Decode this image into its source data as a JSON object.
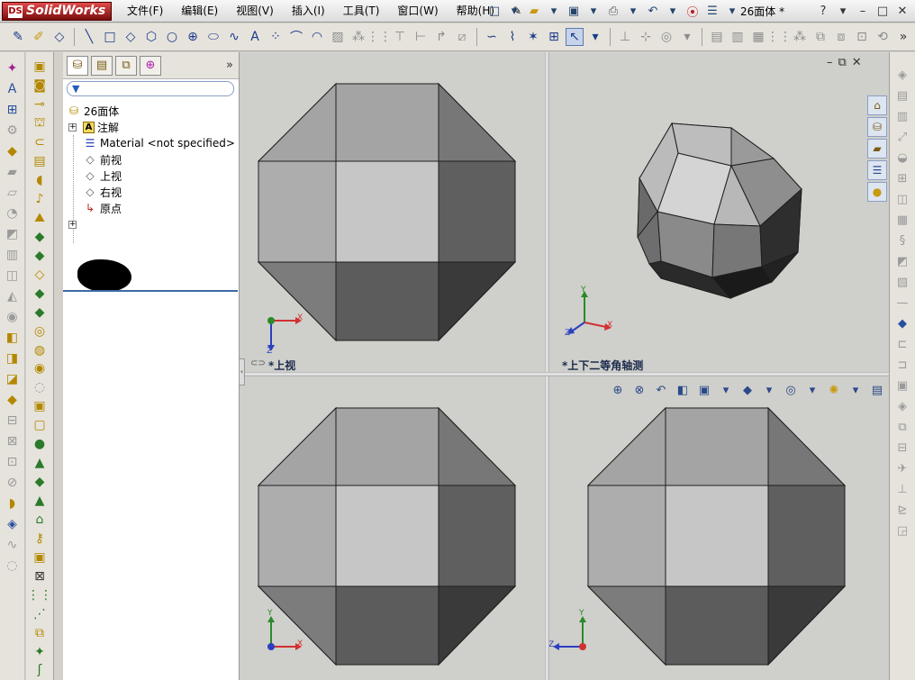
{
  "app": {
    "name": "SolidWorks",
    "document_title": "26面体 *"
  },
  "menu": [
    "文件(F)",
    "编辑(E)",
    "视图(V)",
    "插入(I)",
    "工具(T)",
    "窗口(W)",
    "帮助(H)"
  ],
  "icons": {
    "new": "new-document-icon",
    "open": "open-icon",
    "save": "save-icon",
    "print": "print-icon",
    "undo": "undo-icon",
    "rebuild": "rebuild-icon",
    "options": "options-icon",
    "help": "help-icon",
    "minimize": "minimize-icon",
    "restore": "restore-icon",
    "close": "close-icon"
  },
  "feature_tree": {
    "filter_placeholder": "",
    "root": "26面体",
    "items": [
      {
        "label": "注解",
        "icon": "annotations-icon",
        "expandable": true
      },
      {
        "label": "Material <not specified>",
        "icon": "material-icon",
        "expandable": false
      },
      {
        "label": "前视",
        "icon": "plane-icon",
        "expandable": false
      },
      {
        "label": "上视",
        "icon": "plane-icon",
        "expandable": false
      },
      {
        "label": "右视",
        "icon": "plane-icon",
        "expandable": false
      },
      {
        "label": "原点",
        "icon": "origin-icon",
        "expandable": false
      }
    ]
  },
  "viewports": {
    "top_left": {
      "label": "*上视",
      "triad": {
        "h": "X",
        "v": "Z"
      }
    },
    "top_right": {
      "label": "*上下二等角轴测",
      "triad": {
        "h": "X",
        "v": "Y",
        "d": "Z"
      }
    },
    "bottom_left": {
      "label": "",
      "triad": {
        "h": "X",
        "v": "Y"
      }
    },
    "bottom_right": {
      "label": "",
      "triad": {
        "h": "Z",
        "v": "Y"
      }
    }
  },
  "colors": {
    "face_light": "#c6c6c6",
    "face_mid": "#a4a4a4",
    "face_dark": "#5e5e5e",
    "face_darker": "#3a3a3a",
    "axis_x": "#d23030",
    "axis_y": "#2a8a2a",
    "axis_z": "#2a3fbf",
    "background": "#cfcfcb"
  }
}
